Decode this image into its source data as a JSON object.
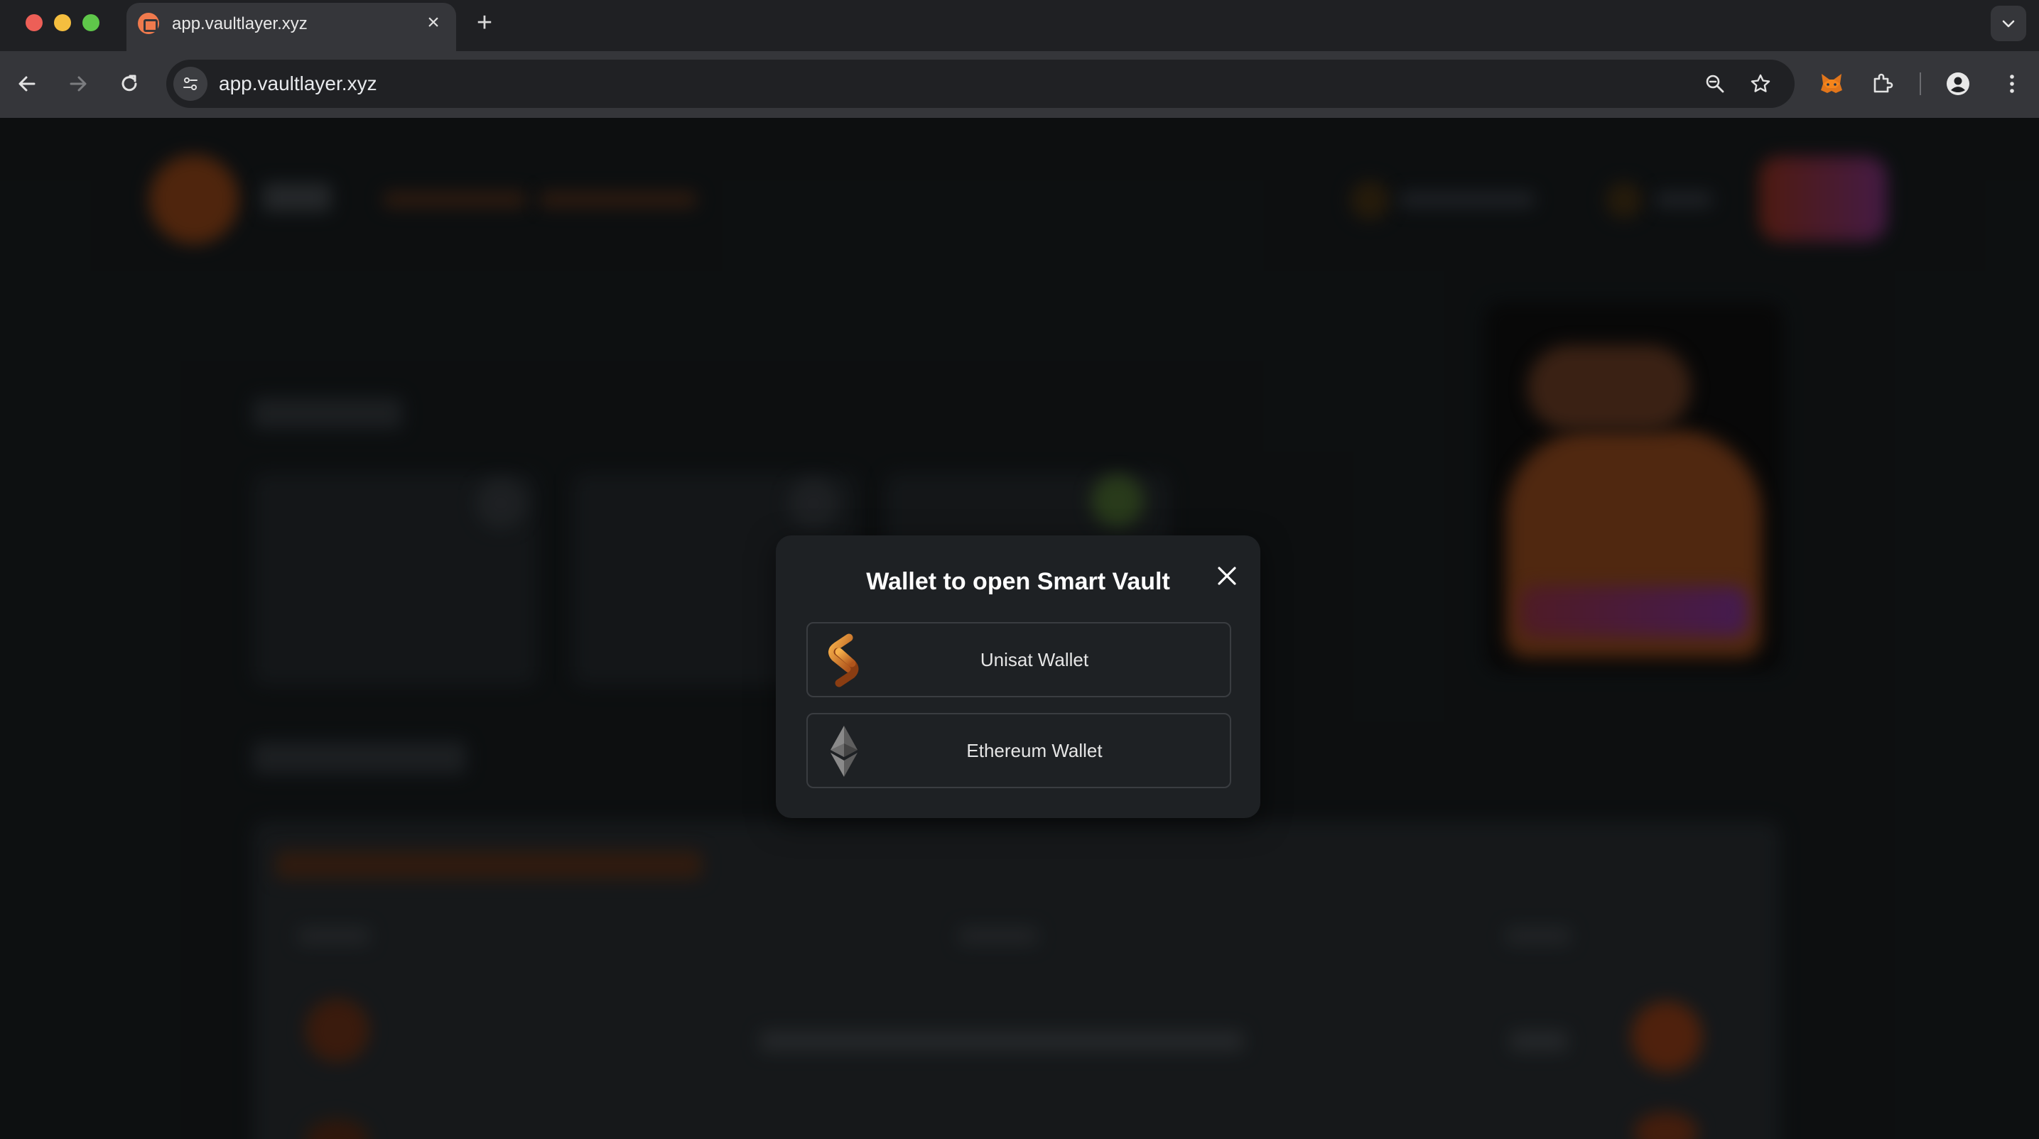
{
  "browser": {
    "tab_title": "app.vaultlayer.xyz",
    "url": "app.vaultlayer.xyz",
    "icons": [
      "back-arrow-icon",
      "forward-arrow-icon",
      "reload-icon",
      "site-info-icon",
      "zoom-icon",
      "bookmark-star-icon",
      "metamask-fox-icon",
      "extensions-puzzle-icon",
      "profile-icon",
      "menu-dots-icon",
      "tab-search-chevron-icon"
    ]
  },
  "modal": {
    "title": "Wallet to open Smart Vault",
    "wallets": [
      {
        "label": "Unisat Wallet",
        "icon": "unisat-logo-icon"
      },
      {
        "label": "Ethereum Wallet",
        "icon": "ethereum-logo-icon"
      }
    ]
  },
  "colors": {
    "accent": "#e07a2f",
    "modal_bg": "#1e2124",
    "page_bg": "#14181a"
  }
}
